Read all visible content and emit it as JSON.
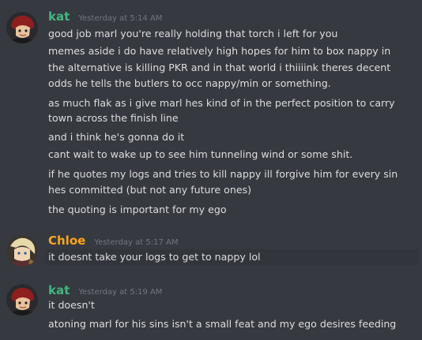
{
  "colors": {
    "background": "#36393f",
    "kat_name": "#43b581",
    "chloe_name": "#faa61a",
    "text": "#dcddde",
    "timestamp": "#72767d"
  },
  "groups": [
    {
      "author": "kat",
      "timestamp": "Yesterday at 5:14 AM",
      "avatar_icon": "kat-avatar-icon",
      "messages": [
        "good job marl you're really holding that torch i left for you",
        "memes aside i do have relatively high hopes for him to box nappy in",
        "the alternative is killing PKR and in that world i thiiiink theres decent",
        "odds he tells the butlers to occ nappy/min or something.",
        "as much flak as i give marl hes kind of in the perfect position to carry",
        "town across the finish line",
        "and i think he's gonna do it",
        "cant wait to wake up to see him tunneling wind or some shit.",
        "if he quotes my logs and tries to kill nappy ill forgive him for every sin",
        "hes committed (but not any future ones)",
        "the quoting is important for my ego"
      ]
    },
    {
      "author": "Chloe",
      "timestamp": "Yesterday at 5:17 AM",
      "avatar_icon": "chloe-avatar-icon",
      "messages": [
        "it doesnt take your logs to get to nappy lol"
      ]
    },
    {
      "author": "kat",
      "timestamp": "Yesterday at 5:19 AM",
      "avatar_icon": "kat-avatar-icon",
      "messages": [
        "it doesn't",
        "atoning marl for his sins isn't a small feat and my ego desires feeding"
      ]
    }
  ]
}
